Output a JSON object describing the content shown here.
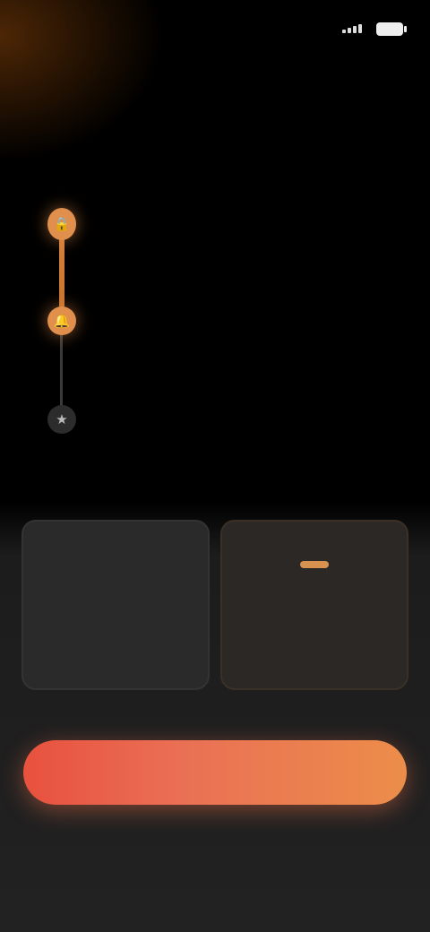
{
  "status_bar": {
    "time": "",
    "battery_level": ""
  },
  "title": "",
  "timeline": {
    "steps": [
      {
        "title": "",
        "description": "",
        "icon": "lock-icon",
        "state": "active"
      },
      {
        "title": "",
        "description": "",
        "icon": "bell-icon",
        "state": "active"
      },
      {
        "title": "",
        "description": "",
        "icon": "star-icon",
        "state": "idle"
      }
    ]
  },
  "plans": [
    {
      "name": "",
      "price": "",
      "subtext": "",
      "badge": "",
      "selected": false
    },
    {
      "name": "",
      "price": "",
      "subtext": "",
      "badge": "",
      "selected": true
    }
  ],
  "note": "",
  "cta_label": "",
  "fineprint": "",
  "footer_links": [
    "",
    "",
    ""
  ],
  "colors": {
    "accent": "#e08f4d",
    "cta_start": "#e8513e",
    "cta_end": "#ec8d4a",
    "background": "#000000"
  }
}
